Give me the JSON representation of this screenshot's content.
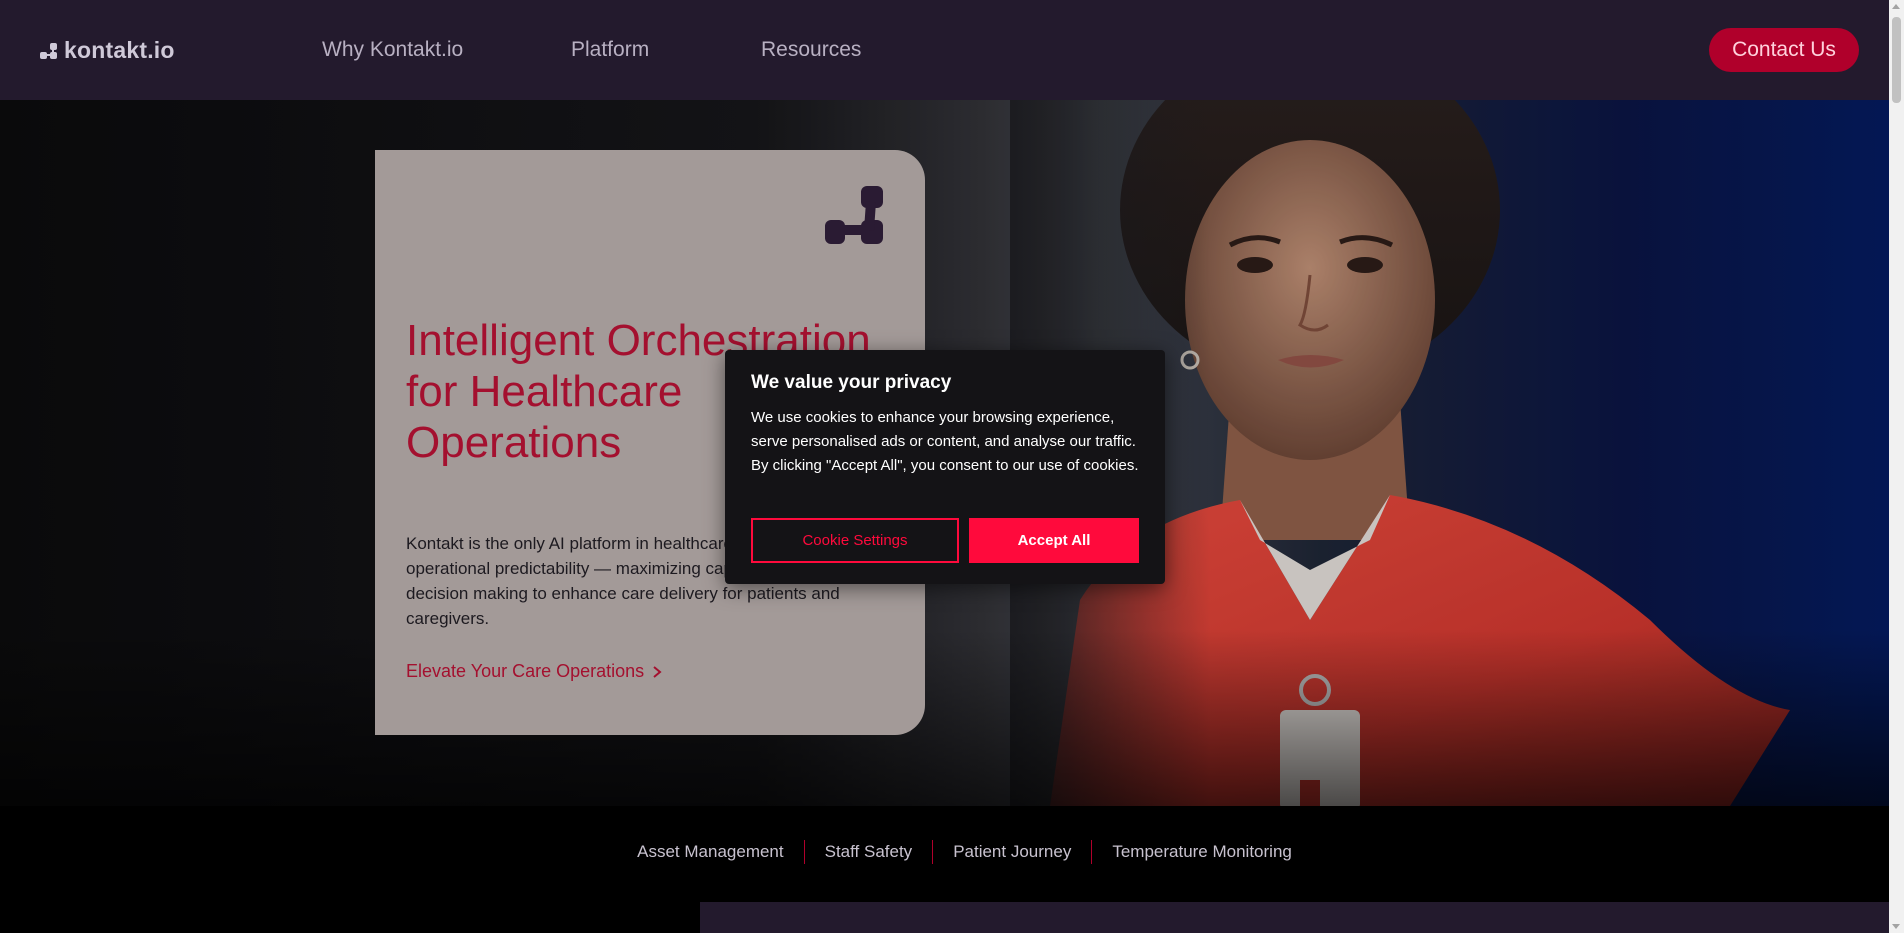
{
  "nav": {
    "logo_text": "kontakt.io",
    "links": [
      "Why Kontakt.io",
      "Platform",
      "Resources"
    ],
    "contact_label": "Contact Us"
  },
  "hero": {
    "title": "Intelligent Orchestration for Healthcare Operations",
    "body": "Kontakt is the only AI platform in healthcare that delivers operational predictability — maximizing capacity, safety, and decision making to enhance care delivery for patients and caregivers.",
    "cta_label": "Elevate Your Care Operations"
  },
  "tabs": [
    "Asset Management",
    "Staff Safety",
    "Patient Journey",
    "Temperature Monitoring"
  ],
  "cookie_modal": {
    "title": "We value your privacy",
    "text": "We use cookies to enhance your browsing experience, serve personalised ads or content, and analyse our traffic. By clicking \"Accept All\", you consent to our use of cookies.",
    "settings_label": "Cookie Settings",
    "accept_label": "Accept All"
  },
  "colors": {
    "nav_bg": "#231a2d",
    "brand_red": "#b0002b",
    "title_red": "#a4102f",
    "card_bg": "#a39a98",
    "modal_bg": "#141316",
    "accept_red": "#ff0a3c"
  },
  "icons": [
    "kontakt-logo-icon",
    "chevron-right-icon"
  ]
}
